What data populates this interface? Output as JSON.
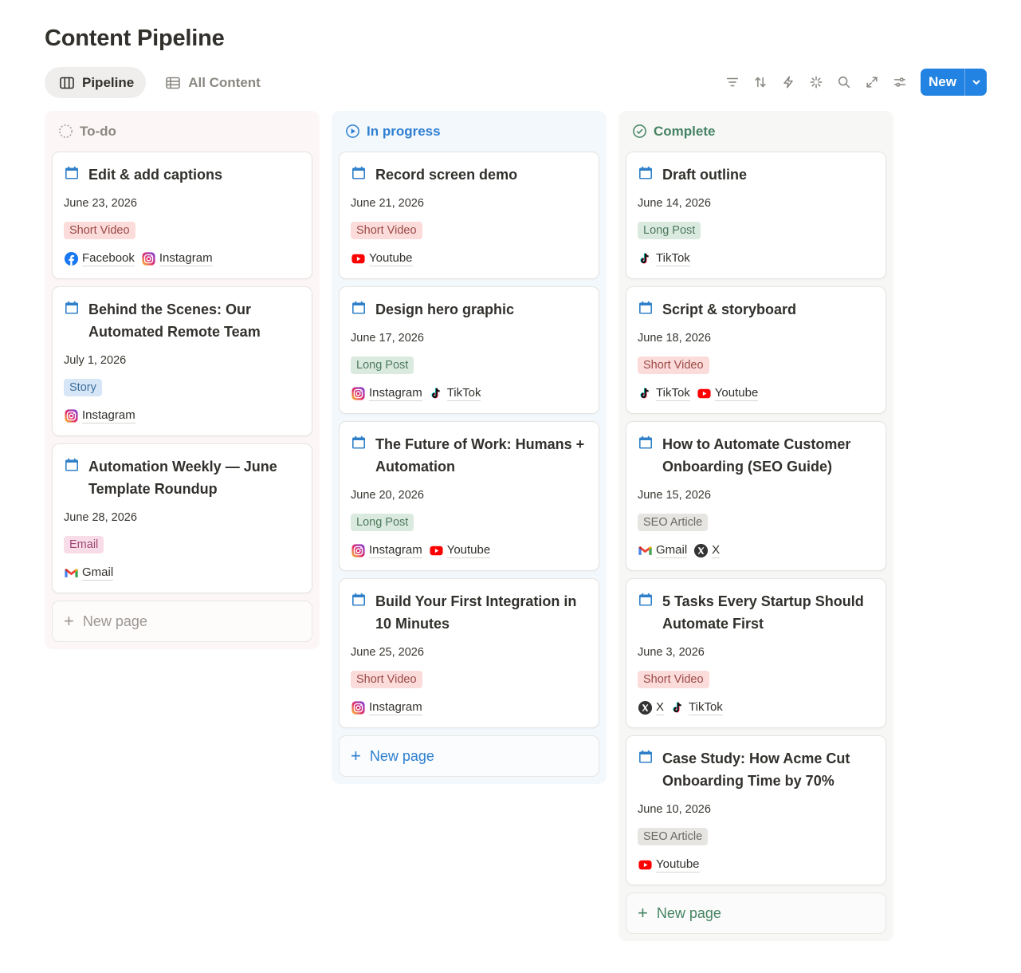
{
  "page": {
    "title": "Content Pipeline"
  },
  "views": [
    {
      "label": "Pipeline",
      "icon": "board-icon",
      "active": true
    },
    {
      "label": "All Content",
      "icon": "table-icon",
      "active": false
    }
  ],
  "toolbar": {
    "icons": [
      "filter-icon",
      "sort-icon",
      "automation-icon",
      "ai-sparkle-icon",
      "search-icon",
      "expand-icon",
      "settings-icon"
    ],
    "new_label": "New"
  },
  "colors": {
    "accent": "#2383e2",
    "todo": "#8a8782",
    "in_progress": "#2e7fd1",
    "complete": "#448361"
  },
  "tag_colors": {
    "Short Video": {
      "bg": "#fbdcdb",
      "fg": "#9b4a45"
    },
    "Long Post": {
      "bg": "#dbeadf",
      "fg": "#4e7a5d"
    },
    "Story": {
      "bg": "#d6e6f6",
      "fg": "#3c6f9e"
    },
    "Email": {
      "bg": "#f8dde9",
      "fg": "#9d4672"
    },
    "SEO Article": {
      "bg": "#e6e5e2",
      "fg": "#6b6964"
    }
  },
  "columns": [
    {
      "key": "todo",
      "title": "To-do",
      "new_page_label": "New page",
      "cards": [
        {
          "title": "Edit & add captions",
          "date": "June 23, 2026",
          "tag": "Short Video",
          "platforms": [
            "Facebook",
            "Instagram"
          ]
        },
        {
          "title": "Behind the Scenes: Our Automated Remote Team",
          "date": "July 1, 2026",
          "tag": "Story",
          "platforms": [
            "Instagram"
          ]
        },
        {
          "title": "Automation Weekly — June Template Roundup",
          "date": "June 28, 2026",
          "tag": "Email",
          "platforms": [
            "Gmail"
          ]
        }
      ]
    },
    {
      "key": "progress",
      "title": "In progress",
      "new_page_label": "New page",
      "cards": [
        {
          "title": "Record screen demo",
          "date": "June 21, 2026",
          "tag": "Short Video",
          "platforms": [
            "Youtube"
          ]
        },
        {
          "title": "Design hero graphic",
          "date": "June 17, 2026",
          "tag": "Long Post",
          "platforms": [
            "Instagram",
            "TikTok"
          ]
        },
        {
          "title": "The Future of Work: Humans + Automation",
          "date": "June 20, 2026",
          "tag": "Long Post",
          "platforms": [
            "Instagram",
            "Youtube"
          ]
        },
        {
          "title": "Build Your First Integration in 10 Minutes",
          "date": "June 25, 2026",
          "tag": "Short Video",
          "platforms": [
            "Instagram"
          ]
        }
      ]
    },
    {
      "key": "complete",
      "title": "Complete",
      "new_page_label": "New page",
      "cards": [
        {
          "title": "Draft outline",
          "date": "June 14, 2026",
          "tag": "Long Post",
          "platforms": [
            "TikTok"
          ]
        },
        {
          "title": "Script & storyboard",
          "date": "June 18, 2026",
          "tag": "Short Video",
          "platforms": [
            "TikTok",
            "Youtube"
          ]
        },
        {
          "title": "How to Automate Customer Onboarding (SEO Guide)",
          "date": "June 15, 2026",
          "tag": "SEO Article",
          "platforms": [
            "Gmail",
            "X"
          ]
        },
        {
          "title": "5 Tasks Every Startup Should Automate First",
          "date": "June 3, 2026",
          "tag": "Short Video",
          "platforms": [
            "X",
            "TikTok"
          ]
        },
        {
          "title": "Case Study: How Acme Cut Onboarding Time by 70%",
          "date": "June 10, 2026",
          "tag": "SEO Article",
          "platforms": [
            "Youtube"
          ]
        }
      ]
    }
  ]
}
